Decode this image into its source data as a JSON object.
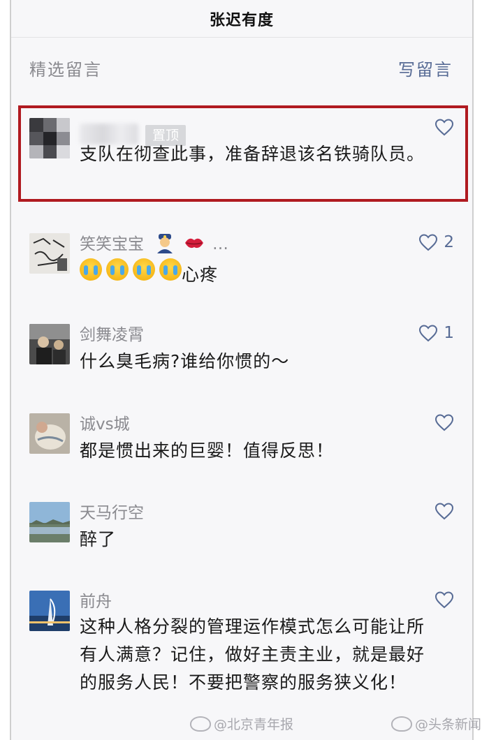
{
  "header": {
    "title": "张迟有度"
  },
  "section": {
    "label": "精选留言",
    "write_label": "写留言"
  },
  "comments": [
    {
      "name": "",
      "badge": "置顶",
      "text": "支队在彻查此事，准备辞退该名铁骑队员。",
      "likes": ""
    },
    {
      "name": "笑笑宝宝",
      "name_suffix": "…",
      "text": "心疼",
      "likes": "2"
    },
    {
      "name": "剑舞凌霄",
      "text": "什么臭毛病?谁给你惯的～",
      "likes": "1"
    },
    {
      "name": "诚vs城",
      "text": "都是惯出来的巨婴！值得反思！",
      "likes": ""
    },
    {
      "name": "天马行空",
      "text": "醉了",
      "likes": ""
    },
    {
      "name": "前舟",
      "text": "这种人格分裂的管理运作模式怎么可能让所有人满意？记住，做好主责主业，就是最好的服务人民！不要把警察的服务狭义化！",
      "likes": ""
    }
  ],
  "icons": {
    "heart": "heart-outline-icon",
    "police": "police-officer-emoji",
    "lips": "kiss-mark-emoji",
    "crying": "loudly-crying-face-emoji",
    "weibo": "weibo-logo-icon"
  },
  "colors": {
    "accent": "#576b95",
    "highlight_border": "#b01a20",
    "muted": "#8a8a8f"
  },
  "watermarks": {
    "left": "@北京青年报",
    "right": "@头条新闻"
  }
}
